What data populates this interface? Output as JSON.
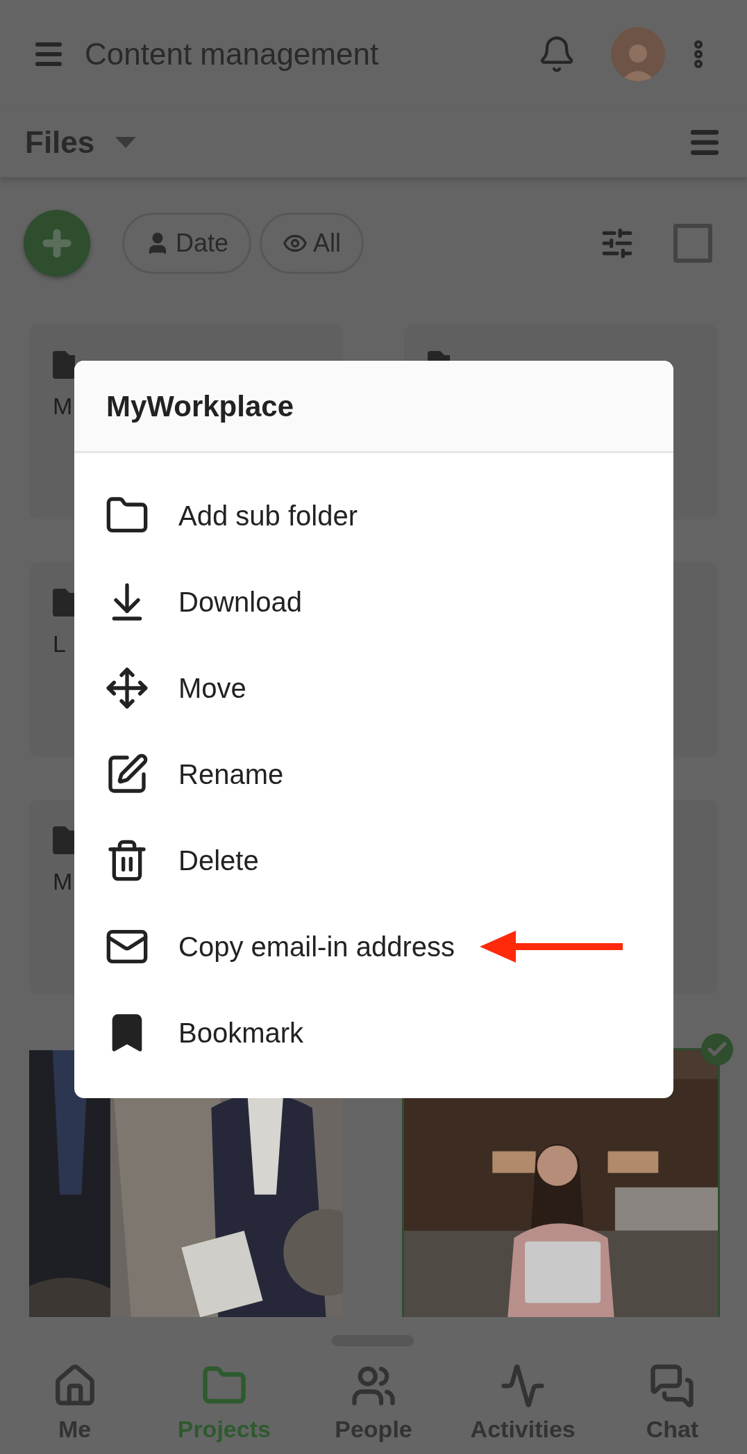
{
  "header": {
    "title": "Content management"
  },
  "section": {
    "title": "Files"
  },
  "chips": [
    {
      "kind": "person",
      "label": "Date"
    },
    {
      "kind": "eye",
      "label": "All"
    }
  ],
  "select_all": {
    "checked": false
  },
  "folders": [
    {
      "kind": "folder",
      "label": "M"
    },
    {
      "kind": "folder"
    },
    {
      "kind": "folder",
      "label": "L"
    },
    {
      "kind": "blank"
    },
    {
      "kind": "folder",
      "label": "M"
    },
    {
      "kind": "blank"
    }
  ],
  "photos": [
    {
      "kind": "picture",
      "checked": false
    },
    {
      "kind": "picture",
      "checked": true
    }
  ],
  "menu": {
    "title": "MyWorkplace",
    "items": [
      {
        "kind": "folder",
        "label": "Add sub folder"
      },
      {
        "kind": "download",
        "label": "Download"
      },
      {
        "kind": "move",
        "label": "Move"
      },
      {
        "kind": "rename",
        "label": "Rename"
      },
      {
        "kind": "delete",
        "label": "Delete"
      },
      {
        "kind": "email",
        "label": "Copy email-in address",
        "pointed": true
      },
      {
        "kind": "bookmark",
        "label": "Bookmark"
      }
    ]
  },
  "nav": [
    {
      "kind": "home",
      "label": "Me",
      "selected": false
    },
    {
      "kind": "folder",
      "label": "Projects",
      "selected": true
    },
    {
      "kind": "people",
      "label": "People",
      "selected": false
    },
    {
      "kind": "activity",
      "label": "Activities",
      "selected": false
    },
    {
      "kind": "chat",
      "label": "Chat",
      "selected": false
    }
  ]
}
